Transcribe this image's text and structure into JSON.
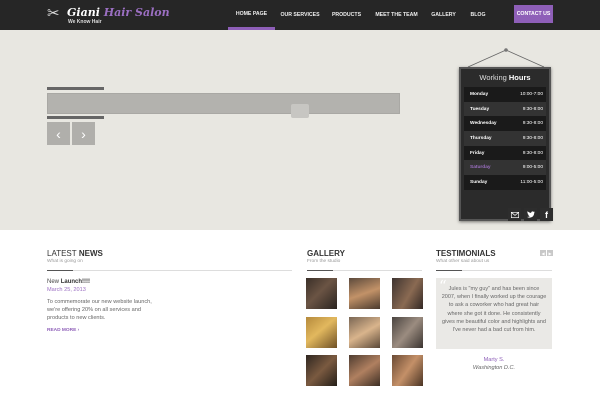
{
  "header": {
    "logo_name": "Giani",
    "logo_accent": "Hair Salon",
    "tagline": "We Know Hair",
    "nav": [
      {
        "label": "HOME PAGE",
        "width": 47
      },
      {
        "label": "OUR SERVICES",
        "width": 50
      },
      {
        "label": "PRODUCTS",
        "width": 43
      },
      {
        "label": "MEET THE TEAM",
        "width": 57
      },
      {
        "label": "GALLERY",
        "width": 37
      },
      {
        "label": "BLOG",
        "width": 32
      }
    ],
    "contact_label": "CONTACT US"
  },
  "hours": {
    "title_light": "Working",
    "title_bold": "Hours",
    "rows": [
      {
        "day": "Monday",
        "time": "10:00-7:00"
      },
      {
        "day": "Tuesday",
        "time": "9:30-8:00"
      },
      {
        "day": "Wednesday",
        "time": "9:30-8:00"
      },
      {
        "day": "Thursday",
        "time": "9:30-8:00"
      },
      {
        "day": "Friday",
        "time": "9:30-8:00"
      },
      {
        "day": "Saturday",
        "time": "9:00-5:00"
      },
      {
        "day": "Sunday",
        "time": "11:00-5:00"
      }
    ]
  },
  "news": {
    "title_light": "LATEST",
    "title_bold": "NEWS",
    "subtitle": "What is going on",
    "item_title_light": "New",
    "item_title_bold": "Launch!!!!",
    "item_date": "March 25, 2013",
    "item_body": "To commemorate our new website launch, we're offering 20% on all services and products to new clients.",
    "read_more": "READ MORE ›"
  },
  "gallery": {
    "title": "GALLERY",
    "subtitle": "From the studio"
  },
  "testimonials": {
    "title": "TESTIMONIALS",
    "subtitle": "What other said about us",
    "quote": "Jules is \"my guy\" and has been since 2007, when I finally worked up the courage to ask a coworker who had great hair where she got it done. He consistently gives me beautiful color and highlights and I've never had a bad cut from him.",
    "name": "Marty S.",
    "location": "Washington D.C."
  },
  "colors": {
    "accent": "#8e5fb8",
    "header_bg": "#262626",
    "hero_bg": "#e8e7e1"
  }
}
